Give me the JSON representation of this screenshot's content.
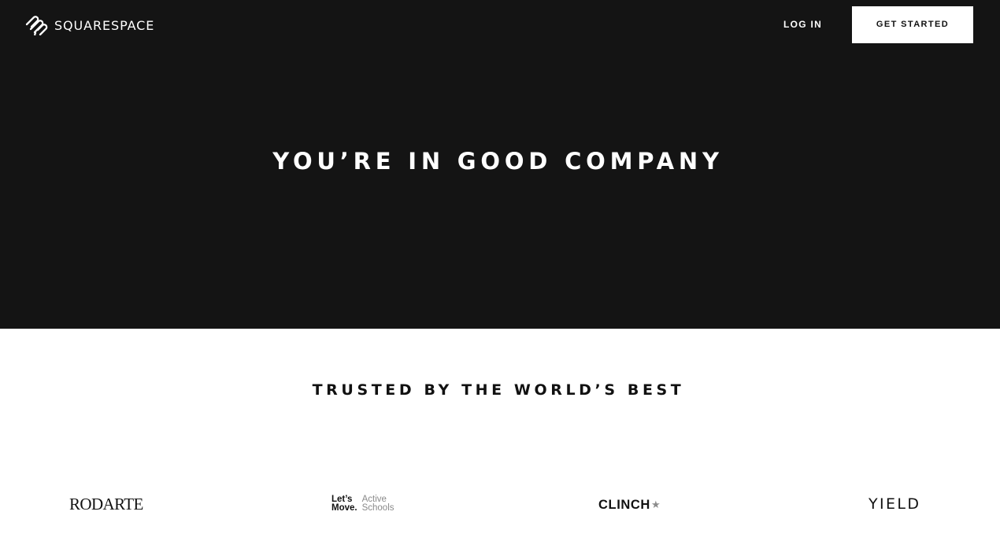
{
  "brand": {
    "name": "SQUARESPACE",
    "icon": "squarespace-logo-icon"
  },
  "nav": {
    "login_label": "LOG IN",
    "cta_label": "GET STARTED"
  },
  "hero": {
    "title": "YOU’RE IN GOOD COMPANY",
    "background_color": "#141414"
  },
  "trusted": {
    "heading": "TRUSTED BY THE WORLD’S BEST",
    "logos": {
      "rodarte": "RODARTE",
      "letsmove": {
        "line1": "Let’s",
        "line2": "Move.",
        "line3": "Active",
        "line4": "Schools"
      },
      "clinch": {
        "text": "CLINCH",
        "star": "★"
      },
      "yield": "YIELD"
    }
  }
}
